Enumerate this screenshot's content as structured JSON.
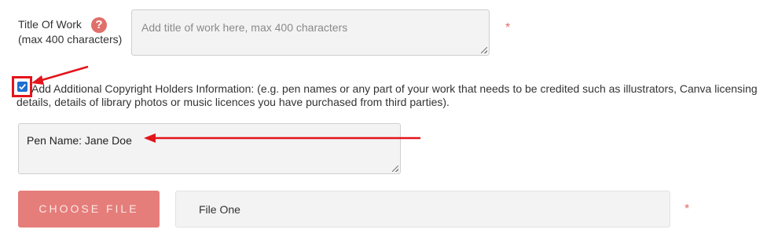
{
  "title_field": {
    "label": "Title Of Work",
    "sublabel": "(max 400 characters)",
    "help_glyph": "?",
    "placeholder": "Add title of work here, max 400 characters",
    "required_mark": "*"
  },
  "copyright": {
    "checked": true,
    "line1": "Add Additional Copyright Holders Information: (e.g. pen names or any part of your work that needs to be credited such as illustrators, Canva licensing",
    "line2": "details, details of library photos or music licences you have purchased from third parties)."
  },
  "pen_name": {
    "value": "Pen Name: Jane Doe"
  },
  "file_row": {
    "button_label": "CHOOSE FILE",
    "file_name": "File One",
    "required_mark": "*"
  },
  "colors": {
    "accent": "#e06f6a",
    "button": "#e57d7a",
    "annotation": "#e3141b",
    "checkbox": "#1f6fd1"
  }
}
